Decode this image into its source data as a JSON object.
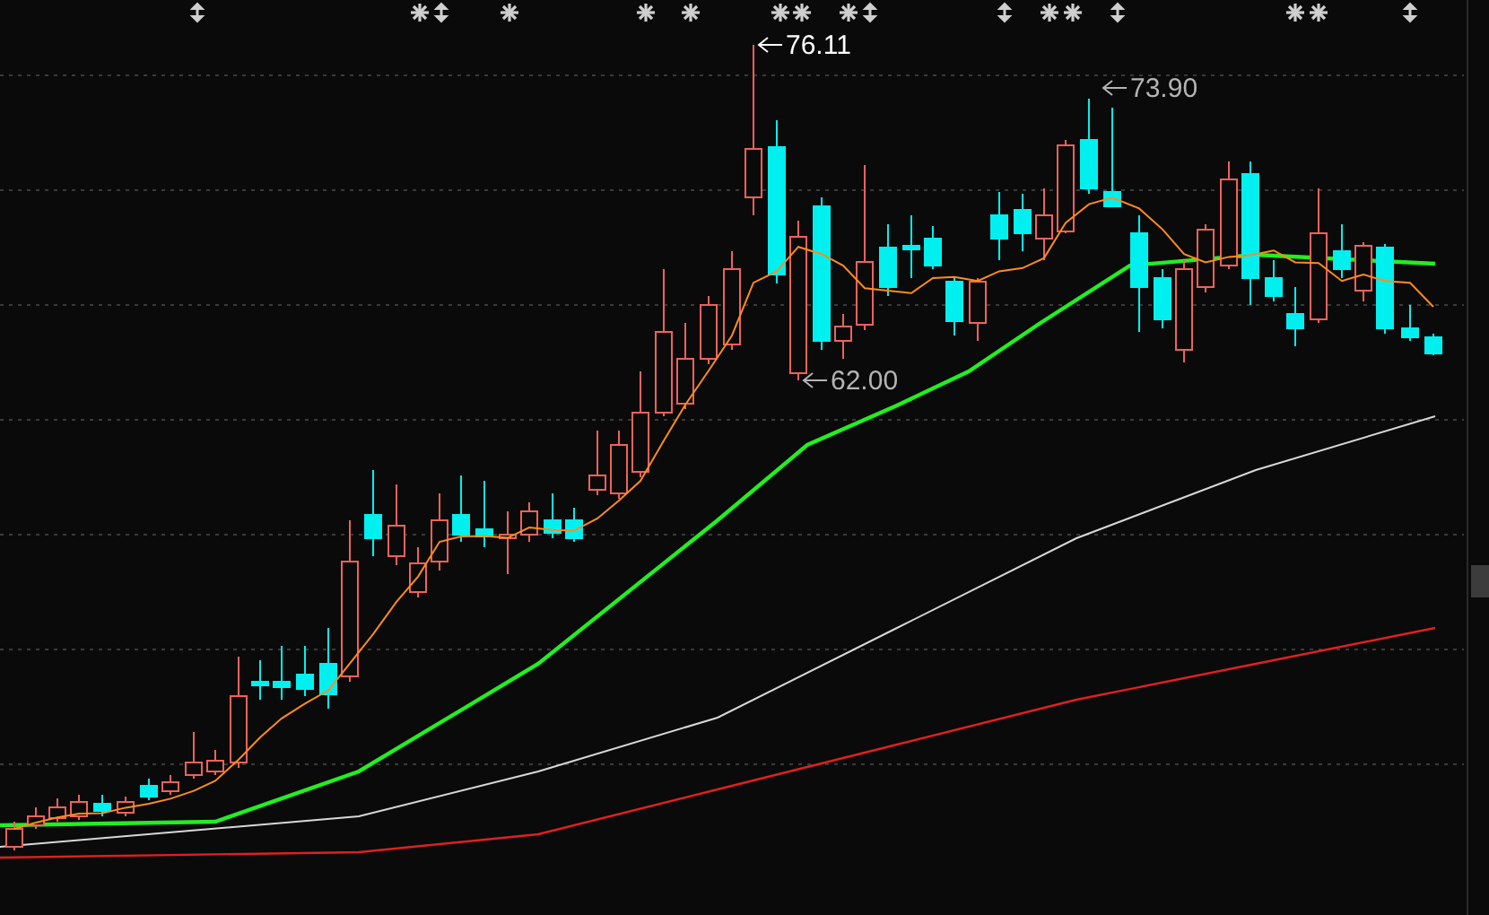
{
  "chart": {
    "price_labels": [
      {
        "text": "76.11",
        "emphasis": true
      },
      {
        "text": "73.90",
        "emphasis": false
      },
      {
        "text": "62.00",
        "emphasis": false
      }
    ]
  }
}
